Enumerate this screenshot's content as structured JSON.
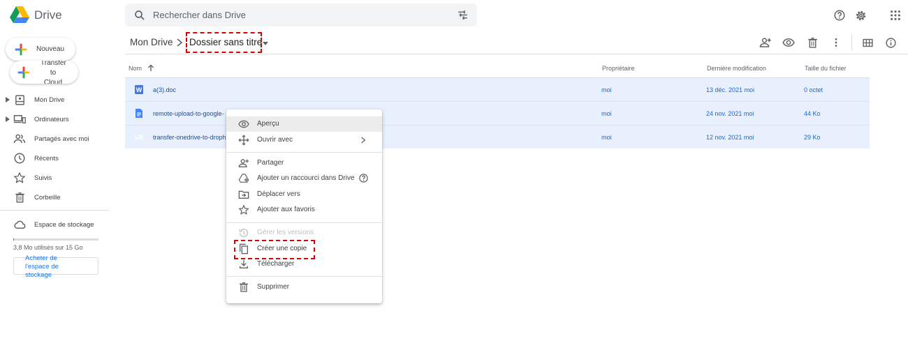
{
  "app": {
    "name": "Drive"
  },
  "search": {
    "placeholder": "Rechercher dans Drive"
  },
  "sidebar": {
    "new_label": "Nouveau",
    "transfer_label": "Transfer to Cloud",
    "items": [
      {
        "label": "Mon Drive",
        "icon": "my-drive-icon"
      },
      {
        "label": "Ordinateurs",
        "icon": "computers-icon"
      },
      {
        "label": "Partagés avec moi",
        "icon": "shared-icon"
      },
      {
        "label": "Récents",
        "icon": "clock-icon"
      },
      {
        "label": "Suivis",
        "icon": "star-icon"
      },
      {
        "label": "Corbeille",
        "icon": "trash-icon"
      }
    ],
    "storage_label": "Espace de stockage",
    "storage_used": "3,8 Mo utilisés sur 15 Go",
    "storage_fraction": 0.0003,
    "buy_label": "Acheter de l'espace de stockage"
  },
  "breadcrumb": {
    "root": "Mon Drive",
    "current": "Dossier sans titre"
  },
  "table": {
    "headers": {
      "name": "Nom",
      "owner": "Propriétaire",
      "modified": "Dernière modification",
      "size": "Taille du fichier"
    },
    "rows": [
      {
        "name": "a(3).doc",
        "type": "word-icon",
        "owner": "moi",
        "modified": "13 déc. 2021",
        "modified_by": "moi",
        "size": "0 octet"
      },
      {
        "name": "remote-upload-to-google-",
        "type": "doc-icon",
        "owner": "moi",
        "modified": "24 nov. 2021",
        "modified_by": "moi",
        "size": "44 Ko"
      },
      {
        "name": "transfer-onedrive-to-droph",
        "type": "image-icon",
        "owner": "moi",
        "modified": "12 nov. 2021",
        "modified_by": "moi",
        "size": "29 Ko"
      }
    ]
  },
  "menu": {
    "items": [
      {
        "label": "Aperçu"
      },
      {
        "label": "Ouvrir avec"
      },
      {
        "label": "Partager"
      },
      {
        "label": "Ajouter un raccourci dans Drive"
      },
      {
        "label": "Déplacer vers"
      },
      {
        "label": "Ajouter aux favoris"
      },
      {
        "label": "Gérer les versions"
      },
      {
        "label": "Créer une copie"
      },
      {
        "label": "Télécharger"
      },
      {
        "label": "Supprimer"
      }
    ]
  },
  "colors": {
    "accent": "#1a73e8",
    "selection": "#e8f0fe",
    "highlight": "#d90000"
  }
}
